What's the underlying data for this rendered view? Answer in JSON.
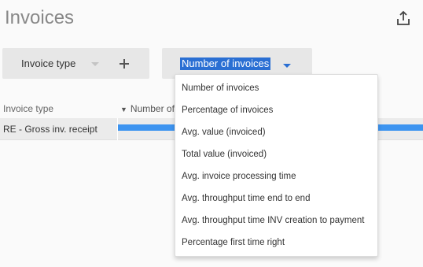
{
  "page": {
    "title": "Invoices"
  },
  "toolbar": {
    "dimension_label": "Invoice type",
    "kpi_label": "Number of invoices"
  },
  "table": {
    "headers": [
      "Invoice type",
      "Number of"
    ],
    "rows": [
      {
        "label": "RE - Gross inv. receipt",
        "value_fraction": 1.0
      }
    ],
    "bar_color": "#3d94f0"
  },
  "dropdown": {
    "items": [
      "Number of invoices",
      "Percentage of invoices",
      "Avg. value (invoiced)",
      "Total value (invoiced)",
      "Avg. invoice processing time",
      "Avg. throughput time end to end",
      "Avg. throughput time INV creation to payment",
      "Percentage first time right"
    ]
  },
  "colors": {
    "accent": "#2a6fd3",
    "bar": "#3d94f0"
  },
  "icons": {
    "export": "share-export-icon",
    "add": "plus-icon",
    "dropdown": "caret-down-icon",
    "sort": "sort-desc-icon"
  }
}
